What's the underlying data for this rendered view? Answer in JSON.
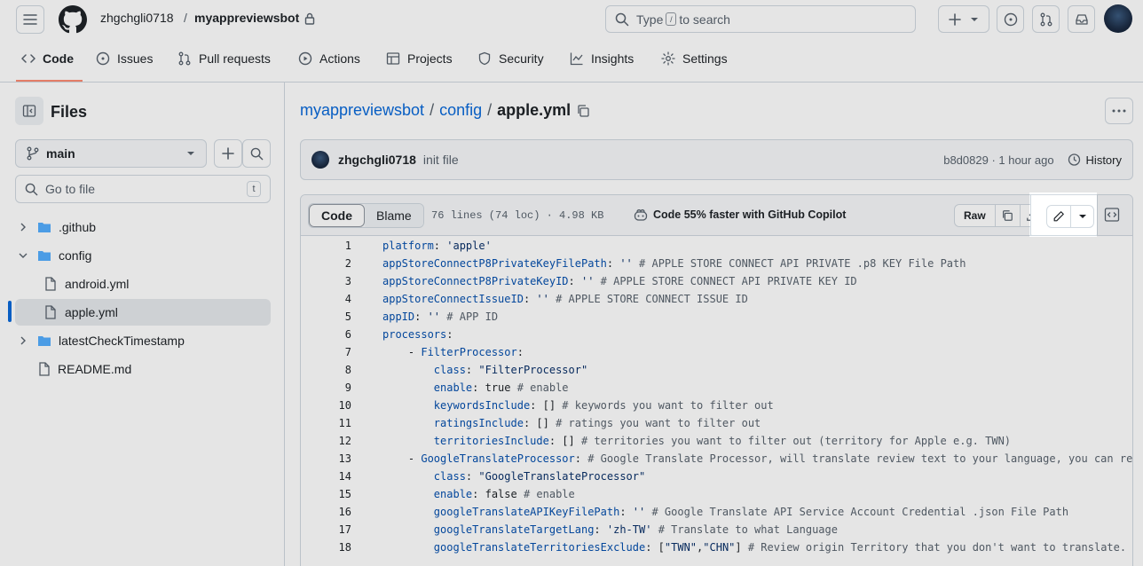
{
  "header": {
    "owner": "zhgchgli0718",
    "separator": "/",
    "repo": "myappreviewsbot",
    "search_placeholder_prefix": "Type",
    "search_placeholder_key": "/",
    "search_placeholder_suffix": "to search"
  },
  "tabs": [
    {
      "label": "Code",
      "icon": "code-icon"
    },
    {
      "label": "Issues",
      "icon": "issue-icon"
    },
    {
      "label": "Pull requests",
      "icon": "pull-request-icon"
    },
    {
      "label": "Actions",
      "icon": "play-icon"
    },
    {
      "label": "Projects",
      "icon": "table-icon"
    },
    {
      "label": "Security",
      "icon": "shield-icon"
    },
    {
      "label": "Insights",
      "icon": "graph-icon"
    },
    {
      "label": "Settings",
      "icon": "gear-icon"
    }
  ],
  "sidebar": {
    "title": "Files",
    "branch": "main",
    "goto_placeholder": "Go to file",
    "goto_shortcut": "t",
    "tree": [
      {
        "label": ".github",
        "type": "folder"
      },
      {
        "label": "config",
        "type": "folder"
      },
      {
        "label": "android.yml",
        "type": "file"
      },
      {
        "label": "apple.yml",
        "type": "file"
      },
      {
        "label": "latestCheckTimestamp",
        "type": "folder"
      },
      {
        "label": "README.md",
        "type": "file"
      }
    ]
  },
  "breadcrumb": {
    "repo": "myappreviewsbot",
    "folder": "config",
    "file": "apple.yml",
    "sep": "/"
  },
  "commit": {
    "author": "zhgchgli0718",
    "message": "init file",
    "meta": "b8d0829 · 1 hour ago",
    "history": "History"
  },
  "code_header": {
    "code_tab": "Code",
    "blame_tab": "Blame",
    "loc": "76 lines (74 loc) · 4.98 KB",
    "copilot": "Code 55% faster with GitHub Copilot",
    "raw": "Raw"
  },
  "code_lines": [
    {
      "n": "1",
      "text": "platform: 'apple'"
    },
    {
      "n": "2",
      "text": "appStoreConnectP8PrivateKeyFilePath: '' # APPLE STORE CONNECT API PRIVATE .p8 KEY File Path"
    },
    {
      "n": "3",
      "text": "appStoreConnectP8PrivateKeyID: '' # APPLE STORE CONNECT API PRIVATE KEY ID"
    },
    {
      "n": "4",
      "text": "appStoreConnectIssueID: '' # APPLE STORE CONNECT ISSUE ID"
    },
    {
      "n": "5",
      "text": "appID: '' # APP ID"
    },
    {
      "n": "6",
      "text": "processors:"
    },
    {
      "n": "7",
      "text": "    - FilterProcessor:"
    },
    {
      "n": "8",
      "text": "        class: \"FilterProcessor\""
    },
    {
      "n": "9",
      "text": "        enable: true # enable"
    },
    {
      "n": "10",
      "text": "        keywordsInclude: [] # keywords you want to filter out"
    },
    {
      "n": "11",
      "text": "        ratingsInclude: [] # ratings you want to filter out"
    },
    {
      "n": "12",
      "text": "        territoriesInclude: [] # territories you want to filter out (territory for Apple e.g. TWN)"
    },
    {
      "n": "13",
      "text": "    - GoogleTranslateProcessor: # Google Translate Processor, will translate review text to your language, you can re"
    },
    {
      "n": "14",
      "text": "        class: \"GoogleTranslateProcessor\""
    },
    {
      "n": "15",
      "text": "        enable: false # enable"
    },
    {
      "n": "16",
      "text": "        googleTranslateAPIKeyFilePath: '' # Google Translate API Service Account Credential .json File Path"
    },
    {
      "n": "17",
      "text": "        googleTranslateTargetLang: 'zh-TW' # Translate to what Language"
    },
    {
      "n": "18",
      "text": "        googleTranslateTerritoriesExclude: [\"TWN\",\"CHN\"] # Review origin Territory that you don't want to translate."
    }
  ]
}
